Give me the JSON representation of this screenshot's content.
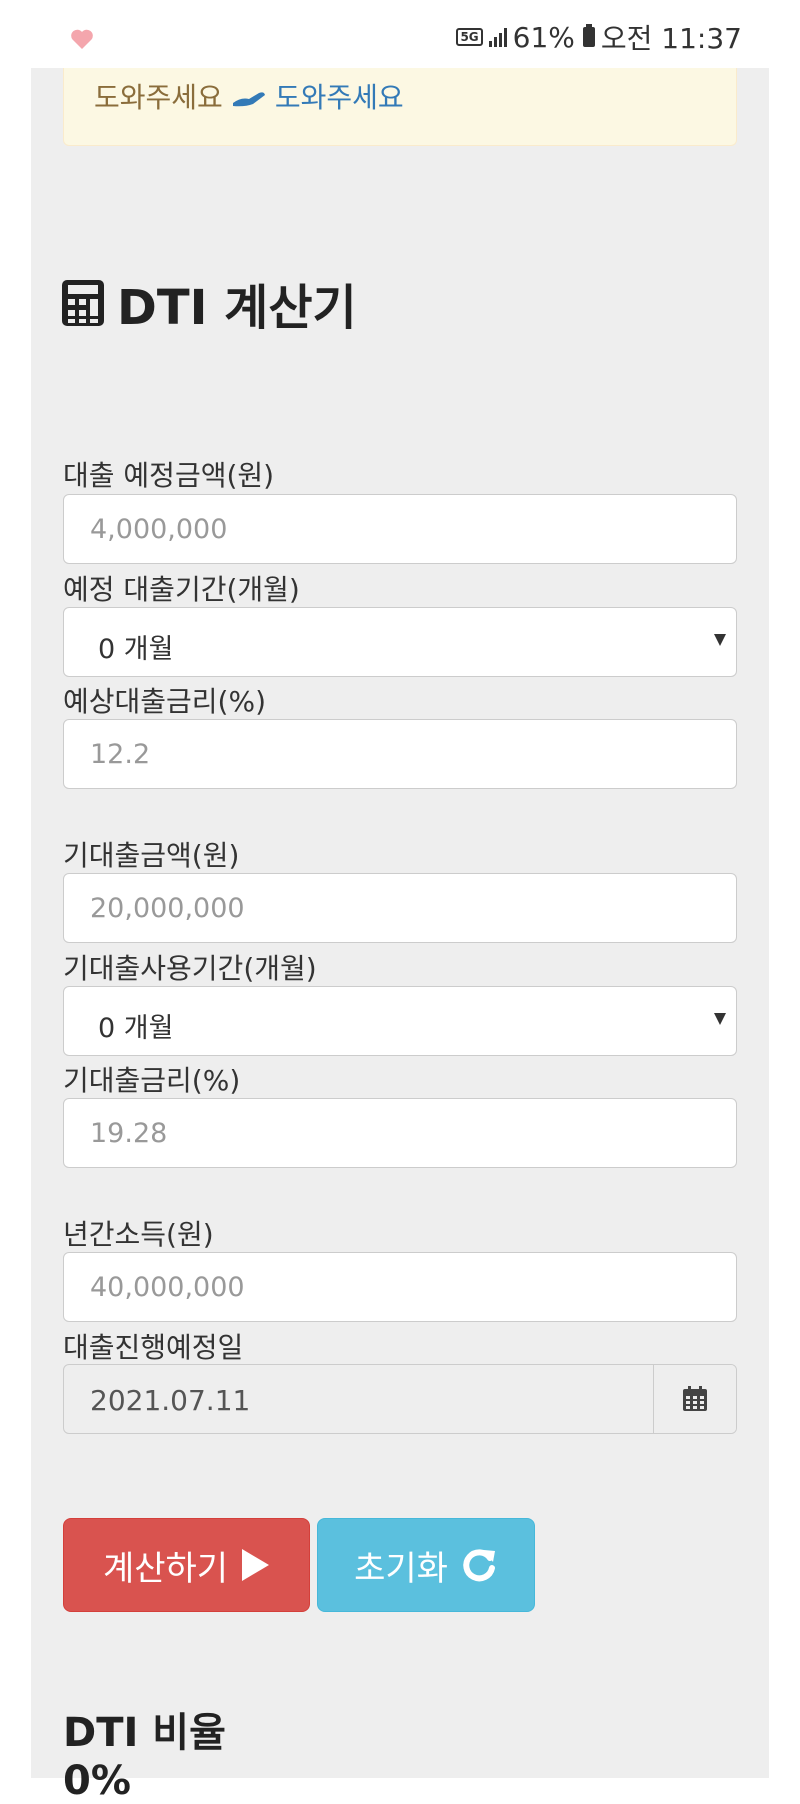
{
  "status_bar": {
    "network": "5G",
    "battery": "61%",
    "time": "오전 11:37"
  },
  "notice": {
    "text": "도와주세요",
    "link": "도와주세요"
  },
  "title": "DTI 계산기",
  "fields": {
    "loan_amount": {
      "label": "대출 예정금액(원)",
      "placeholder": "4,000,000"
    },
    "loan_period": {
      "label": "예정 대출기간(개월)",
      "selected": "0 개월"
    },
    "loan_rate": {
      "label": "예상대출금리(%)",
      "placeholder": "12.2"
    },
    "existing_amount": {
      "label": "기대출금액(원)",
      "placeholder": "20,000,000"
    },
    "existing_period": {
      "label": "기대출사용기간(개월)",
      "selected": "0 개월"
    },
    "existing_rate": {
      "label": "기대출금리(%)",
      "placeholder": "19.28"
    },
    "annual_income": {
      "label": "년간소득(원)",
      "placeholder": "40,000,000"
    },
    "loan_date": {
      "label": "대출진행예정일",
      "value": "2021.07.11"
    }
  },
  "buttons": {
    "calculate": "계산하기",
    "reset": "초기화"
  },
  "result": {
    "title": "DTI 비율",
    "value": "0%"
  }
}
